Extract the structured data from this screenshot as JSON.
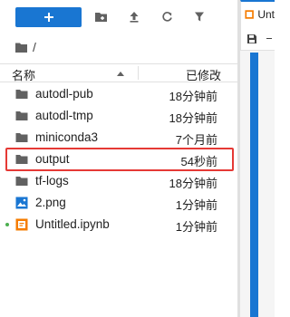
{
  "toolbar": {
    "new_button": {
      "icon": "plus-icon",
      "label": "+"
    },
    "icons": [
      "new-folder-icon",
      "upload-icon",
      "refresh-icon",
      "filter-icon"
    ]
  },
  "breadcrumb": {
    "separator": "/"
  },
  "header": {
    "name_label": "名称",
    "modified_label": "已修改",
    "sort_icon": "sort-ascending-icon"
  },
  "files": [
    {
      "name": "autodl-pub",
      "modified": "18分钟前",
      "type": "folder"
    },
    {
      "name": "autodl-tmp",
      "modified": "18分钟前",
      "type": "folder"
    },
    {
      "name": "miniconda3",
      "modified": "7个月前",
      "type": "folder"
    },
    {
      "name": "output",
      "modified": "54秒前",
      "type": "folder",
      "highlighted": true
    },
    {
      "name": "tf-logs",
      "modified": "18分钟前",
      "type": "folder"
    },
    {
      "name": "2.png",
      "modified": "1分钟前",
      "type": "image"
    },
    {
      "name": "Untitled.ipynb",
      "modified": "1分钟前",
      "type": "notebook",
      "running": true
    }
  ],
  "right_panel": {
    "tab_label": "Unt",
    "save_icon": "save-icon"
  },
  "colors": {
    "accent": "#1976d2",
    "highlight_border": "#e53935",
    "running_dot": "#4caf50",
    "notebook_icon": "#f57c00"
  }
}
